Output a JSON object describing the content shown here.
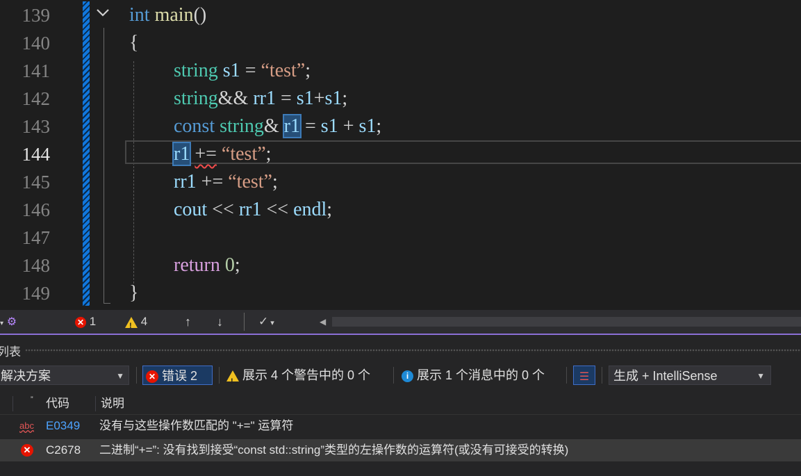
{
  "editor": {
    "line_numbers": [
      "139",
      "140",
      "141",
      "142",
      "143",
      "144",
      "145",
      "146",
      "147",
      "148",
      "149"
    ],
    "current_line": "144",
    "fold_glyph": "chevron-down",
    "code": {
      "l139": {
        "kw": "int",
        "fn": "main",
        "rest": "()"
      },
      "l140": {
        "brace": "{"
      },
      "l141": {
        "ty": "string",
        "va": "s1",
        "op": " = ",
        "st": "“test”",
        "end": ";"
      },
      "l142": {
        "ty": "string",
        "op1": "&& ",
        "va": "rr1",
        "op2": " = ",
        "va2": "s1",
        "op3": "+",
        "va3": "s1",
        "end": ";"
      },
      "l143": {
        "kw": "const",
        "ty": "string",
        "op1": "& ",
        "va": "r1",
        "op2": " = ",
        "va2": "s1",
        "op3": " + ",
        "va3": "s1",
        "end": ";"
      },
      "l144": {
        "va": "r1",
        "op": "+=",
        "st": "“test”",
        "end": ";"
      },
      "l145": {
        "va": "rr1",
        "op": " += ",
        "st": "“test”",
        "end": ";"
      },
      "l146": {
        "va": "cout",
        "op1": " << ",
        "va2": "rr1",
        "op2": " << ",
        "va3": "endl",
        "end": ";"
      },
      "l148": {
        "ct": "return",
        "nm": "0",
        "end": ";"
      },
      "l149": {
        "brace": "}"
      }
    }
  },
  "status_strip": {
    "error_count": "1",
    "warning_count": "4",
    "up_arrow": "↑",
    "down_arrow": "↓"
  },
  "error_list": {
    "title": "列表",
    "scope": "解决方案",
    "errors_button": "错误 2",
    "warnings_button": "展示 4 个警告中的 0 个",
    "messages_button": "展示 1 个消息中的 0 个",
    "build_filter": "生成 + IntelliSense",
    "columns": {
      "code": "代码",
      "description": "说明"
    },
    "rows": [
      {
        "icon": "abc",
        "code": "E0349",
        "description": "没有与这些操作数匹配的 \"+=\" 运算符"
      },
      {
        "icon": "✕",
        "code": "C2678",
        "description": "二进制“+=”: 没有找到接受“const std::string”类型的左操作数的运算符(或没有可接受的转换)"
      }
    ]
  },
  "colors": {
    "accent": "#007acc",
    "error": "#e51400",
    "warning": "#f0c020",
    "info": "#1e8ad6"
  }
}
